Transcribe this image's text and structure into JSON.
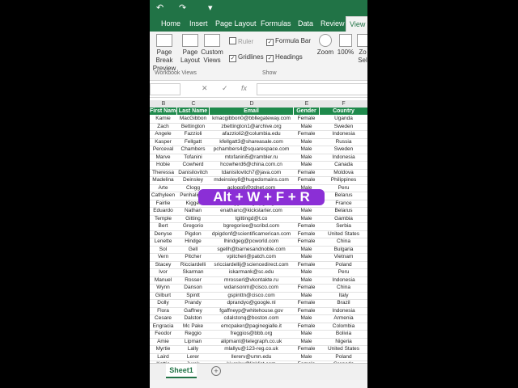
{
  "quick_access": {
    "undo_icon": "↶",
    "redo_icon": "↷",
    "more_icon": "▾"
  },
  "tabs": [
    "Home",
    "Insert",
    "Page Layout",
    "Formulas",
    "Data",
    "Review",
    "View"
  ],
  "active_tab": "View",
  "ribbon": {
    "page_break_preview": "Page Break Preview",
    "page_layout": "Page Layout",
    "custom_views": "Custom Views",
    "workbook_views_group": "Workbook Views",
    "ruler": "Ruler",
    "formula_bar": "Formula Bar",
    "gridlines": "Gridlines",
    "headings": "Headings",
    "show_group": "Show",
    "zoom": "Zoom",
    "zoom_100": "100%",
    "zoom_sel_partial": "Zo Sel"
  },
  "formula_bar": {
    "cancel_icon": "✕",
    "enter_icon": "✓",
    "fx": "fx"
  },
  "column_letters": [
    "B",
    "C",
    "D",
    "E",
    "F"
  ],
  "table": {
    "headers": [
      "First Name",
      "Last Name",
      "Email",
      "Gender",
      "Country"
    ],
    "rows": [
      [
        "Kamie",
        "MacGibbon",
        "kmacgibbon0@bbllegateway.com",
        "Female",
        "Uganda"
      ],
      [
        "Zach",
        "Bettington",
        "zbettington1@archive.org",
        "Male",
        "Sweden"
      ],
      [
        "Angele",
        "Fazzioli",
        "afazzioli2@columbia.edu",
        "Female",
        "Indonesia"
      ],
      [
        "Kasper",
        "Fellgatt",
        "kfellgatt3@shareasale.com",
        "Male",
        "Russia"
      ],
      [
        "Perceval",
        "Chambers",
        "pchambers4@squarespace.com",
        "Male",
        "Sweden"
      ],
      [
        "Marve",
        "Tofanini",
        "mtofanini5@rambler.ru",
        "Male",
        "Indonesia"
      ],
      [
        "Hobie",
        "Cowherd",
        "hcowherd6@china.com.cn",
        "Male",
        "Canada"
      ],
      [
        "Theressa",
        "Danisilovitch",
        "tdanisilovitch7@java.com",
        "Female",
        "Moldova"
      ],
      [
        "Madelina",
        "Deinsley",
        "mdeinsley8@hugedomains.com",
        "Female",
        "Philippines"
      ],
      [
        "Arte",
        "Clogg",
        "aclogg9@zdnet.com",
        "Male",
        "Peru"
      ],
      [
        "Cathyleen",
        "Penhaligon",
        "cpenhaligona@t.co",
        "Female",
        "Belarus"
      ],
      [
        "Fairlie",
        "Kiggel",
        "fkiggelb@gmpg.org",
        "Female",
        "France"
      ],
      [
        "Eduardo",
        "Nathan",
        "enathanc@kickstarter.com",
        "Male",
        "Belarus"
      ],
      [
        "Temple",
        "Gitting",
        "tgittingd@t.co",
        "Male",
        "Gambia"
      ],
      [
        "Bert",
        "Gregorio",
        "bgregorioe@scribd.com",
        "Female",
        "Serbia"
      ],
      [
        "Denyse",
        "Pigdon",
        "dpigdonf@scientificamerican.com",
        "Female",
        "United States"
      ],
      [
        "Lenette",
        "Hindge",
        "lhindgeg@pcworld.com",
        "Female",
        "China"
      ],
      [
        "Sol",
        "Gell",
        "sgellh@barnesandnoble.com",
        "Male",
        "Bulgaria"
      ],
      [
        "Vern",
        "Pitcher",
        "vpitcheri@patch.com",
        "Male",
        "Vietnam"
      ],
      [
        "Stacey",
        "Ricciardelli",
        "sricciardellij@sciencedirect.com",
        "Female",
        "Poland"
      ],
      [
        "Ivor",
        "Skarman",
        "iskarmank@sc.edu",
        "Male",
        "Peru"
      ],
      [
        "Manuel",
        "Rosser",
        "mrosserl@vkontakte.ru",
        "Male",
        "Indonesia"
      ],
      [
        "Wynn",
        "Danson",
        "wdansonm@cisco.com",
        "Female",
        "China"
      ],
      [
        "Gilburt",
        "Spintt",
        "gspinttn@cisco.com",
        "Male",
        "Italy"
      ],
      [
        "Dolly",
        "Prandy",
        "dprandyo@google.nl",
        "Female",
        "Brazil"
      ],
      [
        "Flora",
        "Gaffney",
        "fgaffneyp@whitehouse.gov",
        "Female",
        "Indonesia"
      ],
      [
        "Cesare",
        "Dalston",
        "cdalstonq@boston.com",
        "Male",
        "Armenia"
      ],
      [
        "Engracia",
        "Mc Pake",
        "emcpaker@paginegialle.it",
        "Female",
        "Colombia"
      ],
      [
        "Feodor",
        "Reggio",
        "freggios@bbb.org",
        "Male",
        "Bolivia"
      ],
      [
        "Amie",
        "Lipman",
        "alipmant@telegraph.co.uk",
        "Male",
        "Nigeria"
      ],
      [
        "Myrtie",
        "Lally",
        "mlallyu@123-reg.co.uk",
        "Female",
        "United States"
      ],
      [
        "Laird",
        "Lerer",
        "llererv@umn.edu",
        "Male",
        "Poland"
      ],
      [
        "Kattie",
        "Jurek",
        "kjurekw@linklist.com",
        "Female",
        "Grenada"
      ]
    ]
  },
  "sheet_tab": "Sheet1",
  "add_sheet_icon": "+",
  "shortcut_overlay": "Alt + W + F + R",
  "colors": {
    "excel_green": "#217346",
    "header_green": "#1f8a4c",
    "overlay_purple": "#8b2fd6"
  }
}
